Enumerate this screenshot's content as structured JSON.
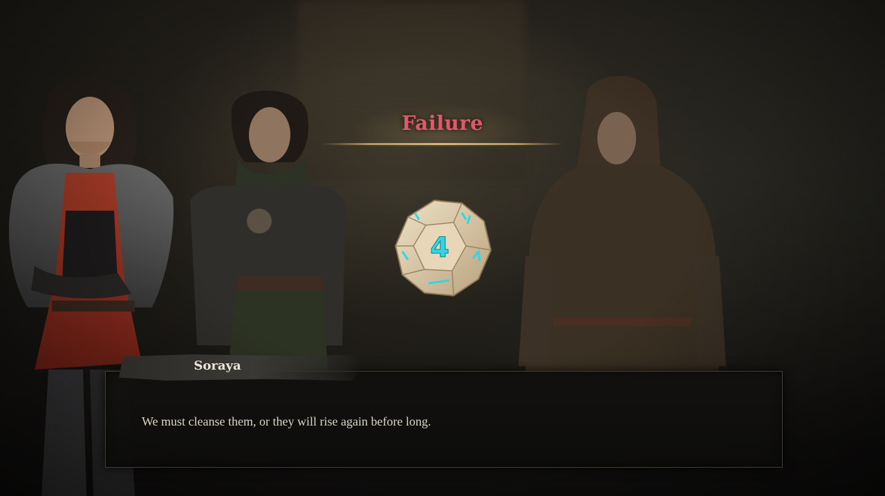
{
  "roll_result": {
    "title": "Failure",
    "title_color": "#e0596a",
    "die_value": "4"
  },
  "dialogue": {
    "speaker": "Soraya",
    "text": "We must cleanse them, or they will rise again before long."
  },
  "characters": [
    {
      "name": "Soraya",
      "role": "speaker"
    },
    {
      "role": "companion"
    },
    {
      "role": "hooded-npc"
    }
  ]
}
